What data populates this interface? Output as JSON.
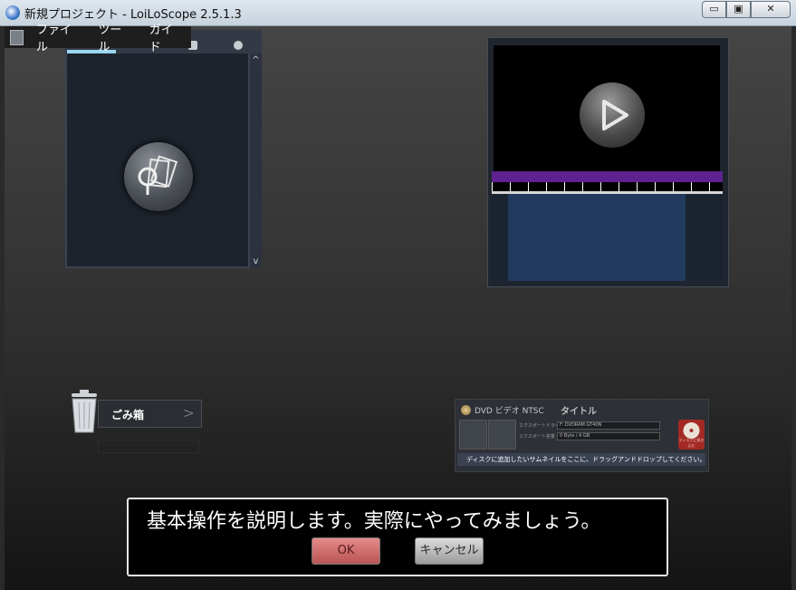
{
  "window": {
    "title": "新規プロジェクト - LoiLoScope 2.5.1.3",
    "controls": [
      "▭",
      "▣",
      "✕"
    ]
  },
  "menubar": {
    "items": [
      "ファイル",
      "ツール",
      "ガイド"
    ]
  },
  "trash": {
    "label": "ごみ箱"
  },
  "dvd_panel": {
    "format_label": "DVD ビデオ NTSC",
    "title_label": "タイトル",
    "field1_label": "エクスポートドライブ",
    "field1_value": "F: DVDRAM GT40N",
    "field2_label": "エクスポート容量",
    "field2_value": "0 Byte / 4 GB",
    "burn_label": "ディスクに焼き込む",
    "drop_hint": "ディスクに追加したいサムネイルをここに、ドラッグアンドドロップしてください。"
  },
  "dialog": {
    "message": "基本操作を説明します。実際にやってみましょう。",
    "ok_label": "OK",
    "cancel_label": "キャンセル"
  },
  "colors": {
    "accent": "#9ad6f0",
    "timeline_purple": "#5d2290",
    "ok_button": "#d06a6a"
  }
}
